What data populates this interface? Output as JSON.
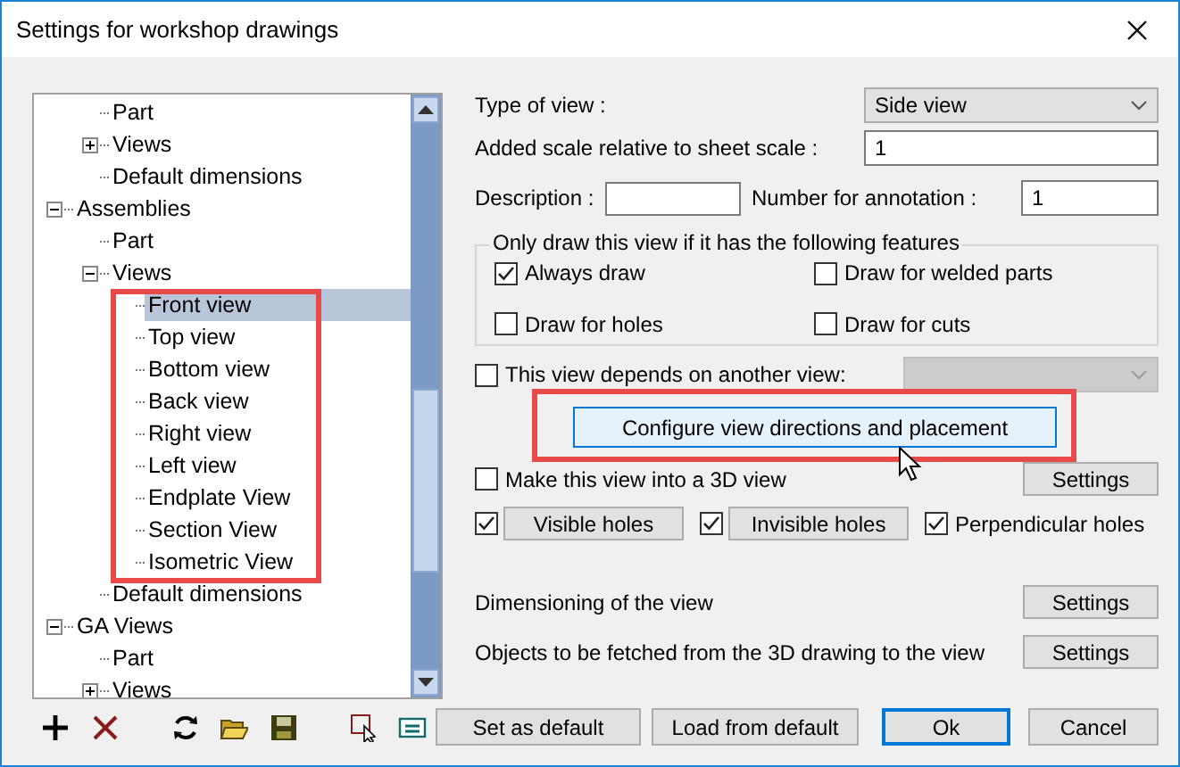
{
  "window": {
    "title": "Settings for workshop drawings"
  },
  "tree": {
    "items": [
      {
        "children": [
          {
            "label": "Part",
            "selected": false
          },
          {
            "label": "Views",
            "expanded": false,
            "selected": false
          },
          {
            "label": "Default dimensions",
            "selected": false
          }
        ]
      },
      {
        "label": "Assemblies",
        "expanded": true,
        "selected": false,
        "children": [
          {
            "label": "Part",
            "selected": false
          },
          {
            "label": "Views",
            "expanded": true,
            "selected": false,
            "children": [
              {
                "label": "Front view",
                "selected": true
              },
              {
                "label": "Top view",
                "selected": false
              },
              {
                "label": "Bottom view",
                "selected": false
              },
              {
                "label": "Back view",
                "selected": false
              },
              {
                "label": "Right view",
                "selected": false
              },
              {
                "label": "Left view",
                "selected": false
              },
              {
                "label": "Endplate View",
                "selected": false
              },
              {
                "label": "Section View",
                "selected": false
              },
              {
                "label": "Isometric View",
                "selected": false
              }
            ]
          },
          {
            "label": "Default dimensions",
            "selected": false
          }
        ]
      },
      {
        "label": "GA Views",
        "expanded": true,
        "selected": false,
        "children": [
          {
            "label": "Part",
            "selected": false
          },
          {
            "label": "Views",
            "expanded": false,
            "selected": false
          }
        ]
      }
    ]
  },
  "form": {
    "type_of_view": {
      "label": "Type of view :",
      "value": "Side view"
    },
    "added_scale": {
      "label": "Added scale relative to sheet scale :",
      "value": "1"
    },
    "description": {
      "label": "Description :"
    },
    "number_for_annotation": {
      "label": "Number for annotation :",
      "value": "1"
    },
    "features": {
      "legend": "Only draw this view if it has the following features",
      "options": [
        {
          "label": "Always draw",
          "checked": true
        },
        {
          "label": "Draw for welded parts",
          "checked": false
        },
        {
          "label": "Draw for holes",
          "checked": false
        },
        {
          "label": "Draw for cuts",
          "checked": false
        }
      ]
    },
    "depends": {
      "label": "This view depends on another view:",
      "checked": false,
      "dropdown_disabled": true
    },
    "configure": {
      "label": "Configure view directions and placement",
      "hovered": true
    },
    "make_3d": {
      "label": "Make this view into a 3D view",
      "checked": false,
      "button": "Settings"
    },
    "holes": [
      {
        "kind": "button",
        "label": "Visible holes",
        "checked": true
      },
      {
        "kind": "button",
        "label": "Invisible holes",
        "checked": true
      },
      {
        "kind": "label",
        "label": "Perpendicular holes",
        "checked": true
      }
    ],
    "sections": [
      {
        "label": "Dimensioning of the view",
        "button": "Settings"
      },
      {
        "label": "Objects to be fetched from the 3D drawing to the view",
        "button": "Settings"
      }
    ]
  },
  "buttons": [
    {
      "label": "Set as default",
      "default": false
    },
    {
      "label": "Load from default",
      "default": false
    },
    {
      "label": "Ok",
      "default": true
    },
    {
      "label": "Cancel",
      "default": false
    }
  ]
}
